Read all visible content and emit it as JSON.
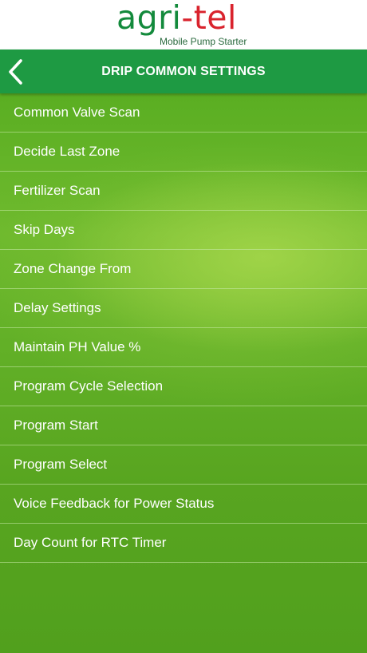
{
  "logo": {
    "word_agri": "agri",
    "word_dash": "-",
    "word_tel": "tel",
    "tagline": "Mobile Pump Starter",
    "colors": {
      "agri": "#138a3c",
      "tel": "#d9232d"
    }
  },
  "header": {
    "title": "DRIP COMMON SETTINGS",
    "back_icon": "chevron-left-icon",
    "bar_color": "#1e9a43"
  },
  "settings": {
    "items": [
      {
        "label": "Common Valve Scan"
      },
      {
        "label": "Decide Last Zone"
      },
      {
        "label": "Fertilizer Scan"
      },
      {
        "label": "Skip Days"
      },
      {
        "label": "Zone Change From"
      },
      {
        "label": "Delay Settings"
      },
      {
        "label": "Maintain PH Value %"
      },
      {
        "label": "Program Cycle Selection"
      },
      {
        "label": "Program Start"
      },
      {
        "label": "Program Select"
      },
      {
        "label": "Voice Feedback for Power Status"
      },
      {
        "label": "Day Count for RTC Timer"
      }
    ]
  }
}
